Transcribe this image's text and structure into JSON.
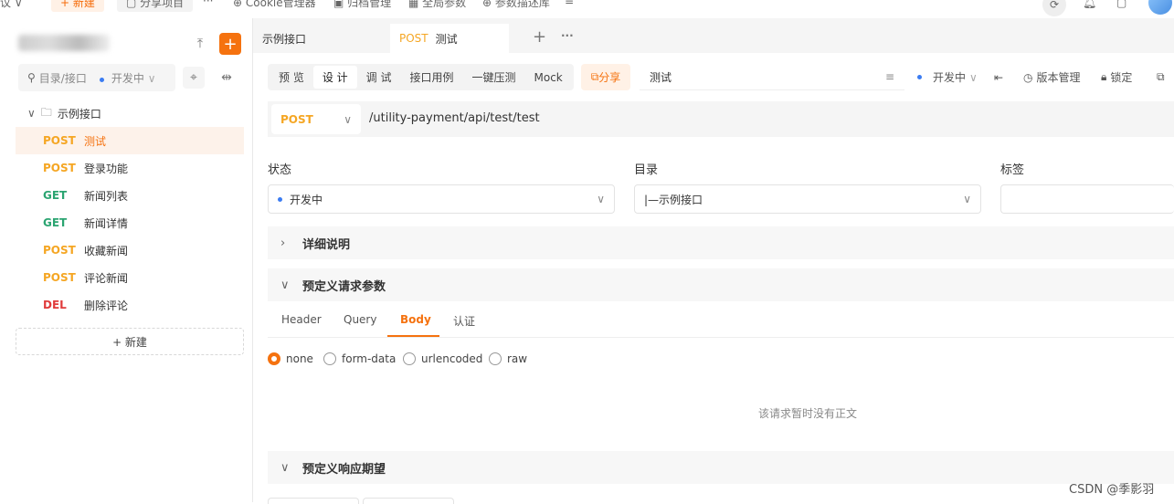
{
  "topbar": {
    "left_fragment": "议 ∨",
    "new": "+ 新建",
    "share_project": "分享项目",
    "more": "···",
    "cookie": "Cookie管理器",
    "archive": "归档管理",
    "global_params": "全局参数",
    "param_desc": "参数描述库"
  },
  "sidebar": {
    "search_placeholder": "目录/接口",
    "status_filter": "开发中",
    "folder": "示例接口",
    "apis": [
      {
        "method": "POST",
        "name": "测试"
      },
      {
        "method": "POST",
        "name": "登录功能"
      },
      {
        "method": "GET",
        "name": "新闻列表"
      },
      {
        "method": "GET",
        "name": "新闻详情"
      },
      {
        "method": "POST",
        "name": "收藏新闻"
      },
      {
        "method": "POST",
        "name": "评论新闻"
      },
      {
        "method": "DEL",
        "name": "删除评论"
      }
    ],
    "new_label": "+ 新建"
  },
  "tabs": [
    {
      "label": "示例接口"
    },
    {
      "method": "POST",
      "label": "测试"
    }
  ],
  "toolbar": {
    "modes": [
      "预 览",
      "设 计",
      "调 试",
      "接口用例",
      "一键压测",
      "Mock"
    ],
    "active_mode": "设 计",
    "share": "分享",
    "name_value": "测试",
    "status": "开发中",
    "version": "版本管理",
    "lock": "锁定"
  },
  "request": {
    "method": "POST",
    "url": "/utility-payment/api/test/test"
  },
  "fields": {
    "status_label": "状态",
    "status_value": "开发中",
    "dir_label": "目录",
    "dir_value": "|—示例接口",
    "tag_label": "标签"
  },
  "sections": {
    "details": "详细说明",
    "request_params": "预定义请求参数",
    "response": "预定义响应期望"
  },
  "param_tabs": [
    "Header",
    "Query",
    "Body",
    "认证"
  ],
  "body_types": [
    "none",
    "form-data",
    "urlencoded",
    "raw"
  ],
  "empty_body": "该请求暂时没有正文",
  "watermark": "CSDN @季影羽",
  "colors": {
    "accent": "#f5720f",
    "post": "#f5a623",
    "get": "#2ba471",
    "del": "#e03b3b"
  }
}
